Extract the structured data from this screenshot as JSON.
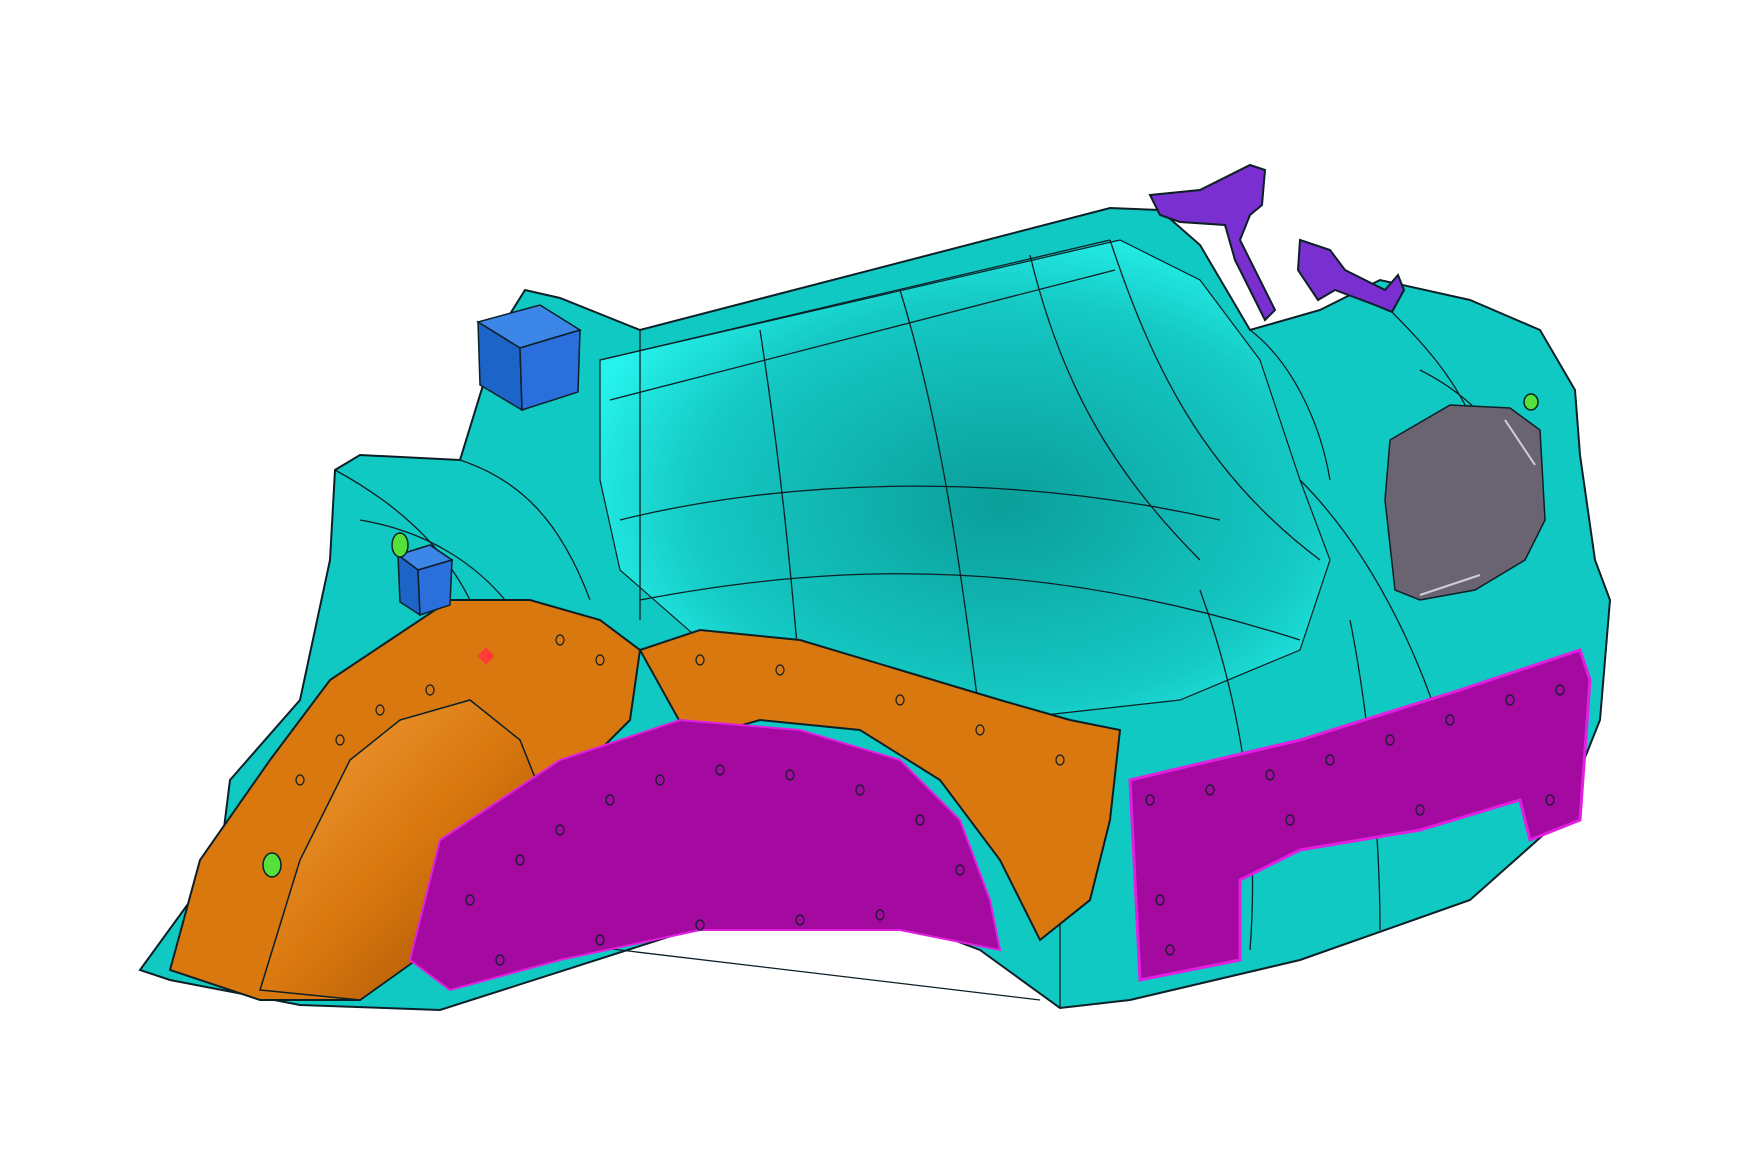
{
  "scene": {
    "background": "#ffffff",
    "colors": {
      "panel_main": "#11c9c3",
      "panel_highlight": "#22f4ee",
      "panel_shadow": "#0a9e9b",
      "wheelhouse_orange": "#d9780e",
      "wheelhouse_orange_light": "#f59a32",
      "liner_magenta": "#a50aa0",
      "liner_magenta_edge": "#e11fe0",
      "block_blue": "#1d64c8",
      "bracket_purple": "#7a2fd0",
      "lamp_opening_gray": "#6a6472",
      "edge_line": "#0b1f26",
      "hole_green": "#56e03c"
    },
    "parts": [
      {
        "name": "quarter-inner-panel",
        "color_key": "panel_main"
      },
      {
        "name": "wheelhouse-outer",
        "color_key": "wheelhouse_orange"
      },
      {
        "name": "wheelhouse-liner",
        "color_key": "liner_magenta"
      },
      {
        "name": "rear-liner-patch",
        "color_key": "liner_magenta"
      },
      {
        "name": "mounting-block-top",
        "color_key": "block_blue"
      },
      {
        "name": "mounting-block-lower",
        "color_key": "block_blue"
      },
      {
        "name": "top-bracket",
        "color_key": "bracket_purple"
      },
      {
        "name": "side-bracket",
        "color_key": "bracket_purple"
      },
      {
        "name": "lamp-opening",
        "color_key": "lamp_opening_gray"
      }
    ]
  }
}
